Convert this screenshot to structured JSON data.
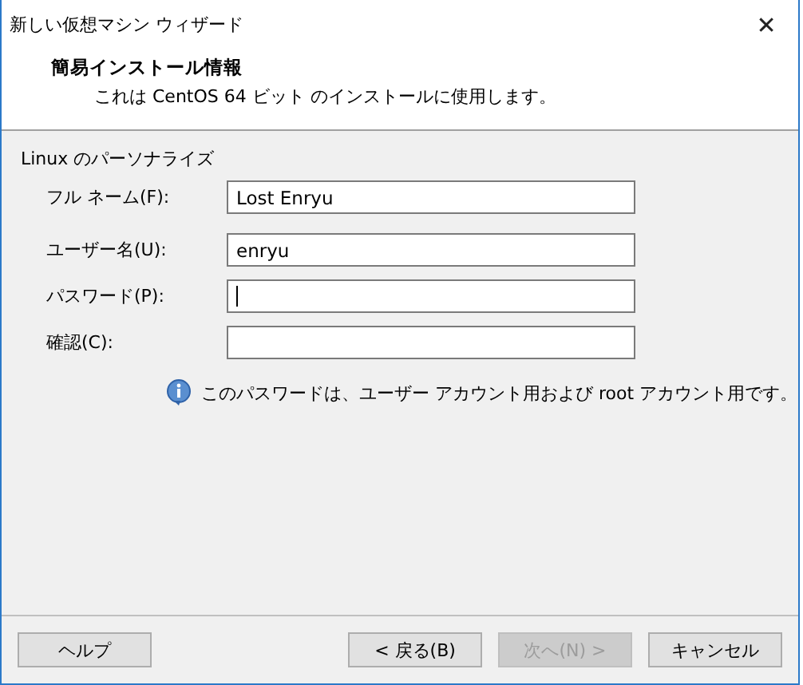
{
  "window": {
    "title": "新しい仮想マシン ウィザード",
    "close": "✕"
  },
  "header": {
    "title": "簡易インストール情報",
    "subtitle": "これは CentOS 64 ビット のインストールに使用します。"
  },
  "group": {
    "label": "Linux のパーソナライズ"
  },
  "fields": [
    {
      "label": "フル ネーム(F):",
      "value": "Lost Enryu",
      "focused": false
    },
    {
      "label": "ユーザー名(U):",
      "value": "enryu",
      "focused": false
    },
    {
      "label": "パスワード(P):",
      "focused": true
    },
    {
      "label": "確認(C):",
      "focused": false
    }
  ],
  "info": "このパスワードは、ユーザー アカウント用および root アカウント用です。",
  "buttons": [
    {
      "label": "ヘルプ",
      "kind": "left",
      "disabled": false
    },
    {
      "label": "< 戻る(B)",
      "kind": "right",
      "disabled": false
    },
    {
      "label": "次へ(N) >",
      "kind": "right",
      "disabled": true
    },
    {
      "label": "キャンセル",
      "kind": "right",
      "disabled": false
    }
  ]
}
